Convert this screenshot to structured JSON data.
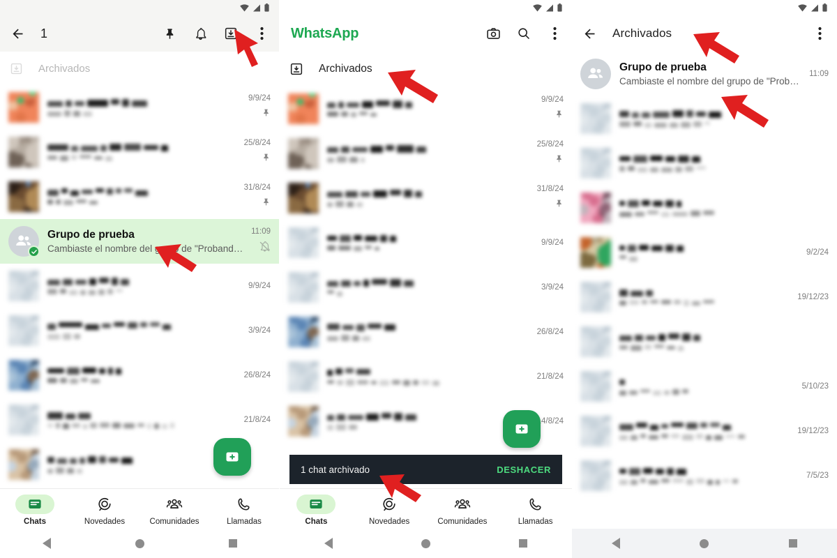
{
  "meta": {
    "accent_green": "#1da851",
    "fab_green": "#21a058",
    "selected_row_bg": "#dcf5d8",
    "snackbar_bg": "#1c232b"
  },
  "status_icons": {
    "wifi": "wifi-icon",
    "signal": "signal-icon",
    "battery": "battery-icon"
  },
  "left_panel": {
    "appbar": {
      "back_label": "back-arrow",
      "title": "1",
      "actions": [
        "pin-icon",
        "bell-icon",
        "archive-icon",
        "more-vert-icon"
      ]
    },
    "archived": {
      "label": "Archivados"
    },
    "chats": [
      {
        "date": "9/9/24",
        "pinned": true,
        "avatar": "orange",
        "name_w": [
          22,
          9,
          14,
          30,
          12,
          10,
          22
        ],
        "msg_w": [
          20,
          9,
          10,
          13
        ]
      },
      {
        "date": "25/8/24",
        "pinned": true,
        "avatar": "taupe",
        "name_w": [
          30,
          10,
          24,
          9,
          17,
          24,
          21,
          10
        ],
        "msg_w": [
          14,
          12,
          8,
          17,
          12,
          10
        ]
      },
      {
        "date": "31/8/24",
        "pinned": true,
        "avatar": "brown",
        "name_w": [
          16,
          9,
          12,
          16,
          12,
          9,
          8,
          12,
          18
        ],
        "msg_w": [
          8,
          7,
          14,
          15,
          12
        ]
      },
      {
        "date": "11:09",
        "pinned": false,
        "avatar": "group",
        "name": "Grupo de prueba",
        "msg": "Cambiaste el nombre del grupo de \"Probando\"...",
        "selected": true,
        "muted": true
      },
      {
        "date": "9/9/24",
        "pinned": false,
        "avatar": "pale",
        "name_w": [
          18,
          14,
          16,
          10,
          14,
          9,
          12
        ],
        "msg_w": [
          14,
          9,
          12,
          8,
          10,
          9,
          8,
          10
        ]
      },
      {
        "date": "3/9/24",
        "pinned": false,
        "avatar": "pale",
        "name_w": [
          12,
          34,
          20,
          13,
          16,
          14,
          10,
          14,
          12
        ],
        "msg_w": [
          18,
          12,
          9
        ]
      },
      {
        "date": "26/8/24",
        "pinned": false,
        "avatar": "blue",
        "name_w": [
          24,
          18,
          20,
          9,
          7,
          8
        ],
        "msg_w": [
          14,
          10,
          12,
          10,
          13
        ]
      },
      {
        "date": "21/8/24",
        "pinned": false,
        "avatar": "pale",
        "name_w": [
          22,
          14,
          18
        ],
        "msg_w": [
          8,
          6,
          9,
          12,
          6,
          10,
          14,
          12,
          16,
          10,
          6,
          7,
          8,
          6
        ]
      },
      {
        "date": "",
        "pinned": false,
        "avatar": "warm",
        "name_w": [
          10,
          14,
          10,
          8,
          12,
          10,
          14,
          16
        ],
        "msg_w": [
          8,
          12,
          10,
          8
        ]
      }
    ],
    "bottom_nav": [
      {
        "label": "Chats",
        "icon": "chats-icon",
        "active": true
      },
      {
        "label": "Novedades",
        "icon": "updates-icon",
        "active": false
      },
      {
        "label": "Comunidades",
        "icon": "communities-icon",
        "active": false
      },
      {
        "label": "Llamadas",
        "icon": "calls-icon",
        "active": false
      }
    ]
  },
  "mid_panel": {
    "appbar": {
      "title": "WhatsApp",
      "actions": [
        "camera-icon",
        "search-icon",
        "more-vert-icon"
      ]
    },
    "archived": {
      "label": "Archivados"
    },
    "chats": [
      {
        "date": "9/9/24",
        "pinned": true,
        "avatar": "orange",
        "name_w": [
          12,
          8,
          18,
          16,
          20,
          14,
          10
        ],
        "msg_w": [
          16,
          10,
          8,
          12,
          9
        ]
      },
      {
        "date": "25/8/24",
        "pinned": true,
        "avatar": "taupe",
        "name_w": [
          16,
          12,
          22,
          18,
          12,
          24,
          14
        ],
        "msg_w": [
          10,
          14,
          12,
          6
        ]
      },
      {
        "date": "31/8/24",
        "pinned": true,
        "avatar": "brown",
        "name_w": [
          22,
          18,
          14,
          20,
          16,
          12,
          10
        ],
        "msg_w": [
          8,
          12,
          10,
          9
        ]
      },
      {
        "date": "9/9/24",
        "pinned": false,
        "avatar": "pale",
        "name_w": [
          14,
          16,
          12,
          18,
          10,
          9
        ],
        "msg_w": [
          12,
          18,
          12,
          10,
          7
        ]
      },
      {
        "date": "3/9/24",
        "pinned": false,
        "avatar": "pale",
        "name_w": [
          16,
          14,
          10,
          8,
          22,
          16,
          14
        ],
        "msg_w": [
          10,
          8
        ]
      },
      {
        "date": "26/8/24",
        "pinned": false,
        "avatar": "blue",
        "name_w": [
          18,
          16,
          12,
          20,
          16
        ],
        "msg_w": [
          16,
          12,
          10,
          12
        ]
      },
      {
        "date": "21/8/24",
        "pinned": false,
        "avatar": "pale",
        "name_w": [
          8,
          10,
          12,
          20
        ],
        "msg_w": [
          10,
          9,
          12,
          16,
          8,
          14,
          12,
          10,
          8,
          12,
          10
        ]
      },
      {
        "date": "14/8/24",
        "pinned": false,
        "avatar": "warm",
        "name_w": [
          10,
          12,
          22,
          18,
          14,
          12,
          16
        ],
        "msg_w": [
          9,
          14,
          12
        ]
      }
    ],
    "snackbar": {
      "text": "1 chat archivado",
      "action": "DESHACER"
    },
    "bottom_nav": [
      {
        "label": "Chats",
        "icon": "chats-icon",
        "active": true
      },
      {
        "label": "Novedades",
        "icon": "updates-icon",
        "active": false
      },
      {
        "label": "Comunidades",
        "icon": "communities-icon",
        "active": false
      },
      {
        "label": "Llamadas",
        "icon": "calls-icon",
        "active": false
      }
    ]
  },
  "right_panel": {
    "appbar": {
      "back_label": "back-arrow",
      "title": "Archivados",
      "actions": [
        "more-vert-icon"
      ]
    },
    "chats": [
      {
        "date": "11:09",
        "avatar": "group",
        "name": "Grupo de prueba",
        "msg": "Cambiaste el nombre del grupo de \"Probando\" a...",
        "highlight": true
      },
      {
        "date": "",
        "avatar": "pale",
        "name_w": [
          14,
          10,
          12,
          24,
          16,
          10,
          14,
          18
        ],
        "msg_w": [
          16,
          12,
          10,
          18,
          12,
          14,
          12,
          8
        ]
      },
      {
        "date": "",
        "avatar": "pale",
        "name_w": [
          16,
          20,
          18,
          14,
          16,
          12
        ],
        "msg_w": [
          8,
          10,
          14,
          12,
          16,
          10,
          12,
          14
        ]
      },
      {
        "date": "",
        "avatar": "pink",
        "name_w": [
          8,
          16,
          12,
          14,
          12,
          7
        ],
        "msg_w": [
          18,
          14,
          16,
          12,
          22,
          14,
          16
        ]
      },
      {
        "date": "9/2/24",
        "avatar": "olive",
        "name_w": [
          8,
          12,
          14,
          16,
          12,
          10
        ],
        "msg_w": [
          10,
          12
        ]
      },
      {
        "date": "19/12/23",
        "avatar": "pale",
        "name_w": [
          12,
          18,
          10
        ],
        "msg_w": [
          10,
          14,
          8,
          12,
          14,
          10,
          8,
          12,
          16
        ]
      },
      {
        "date": "",
        "avatar": "pale",
        "name_w": [
          18,
          12,
          14,
          10,
          16,
          12,
          10
        ],
        "msg_w": [
          12,
          16,
          10,
          14,
          12,
          8
        ]
      },
      {
        "date": "5/10/23",
        "avatar": "pale",
        "name_w": [
          8
        ],
        "msg_w": [
          10,
          12,
          14,
          12,
          8,
          10,
          9
        ]
      },
      {
        "date": "19/12/23",
        "avatar": "pale",
        "name_w": [
          20,
          16,
          12,
          10,
          18,
          16,
          10,
          14,
          12
        ],
        "msg_w": [
          12,
          10,
          8,
          14,
          10,
          12,
          16,
          10,
          8,
          12,
          14,
          10
        ]
      },
      {
        "date": "7/5/23",
        "avatar": "pale",
        "name_w": [
          10,
          16,
          14,
          12,
          10,
          14
        ],
        "msg_w": [
          12,
          10,
          8,
          14,
          12,
          16,
          10,
          12,
          8,
          6,
          10,
          8
        ]
      }
    ]
  },
  "arrows": [
    {
      "name": "arrow-to-archive-button"
    },
    {
      "name": "arrow-to-selected-chat"
    },
    {
      "name": "arrow-to-archived-entry"
    },
    {
      "name": "arrow-to-snackbar"
    },
    {
      "name": "arrow-to-archived-title"
    },
    {
      "name": "arrow-to-archived-chat"
    }
  ]
}
